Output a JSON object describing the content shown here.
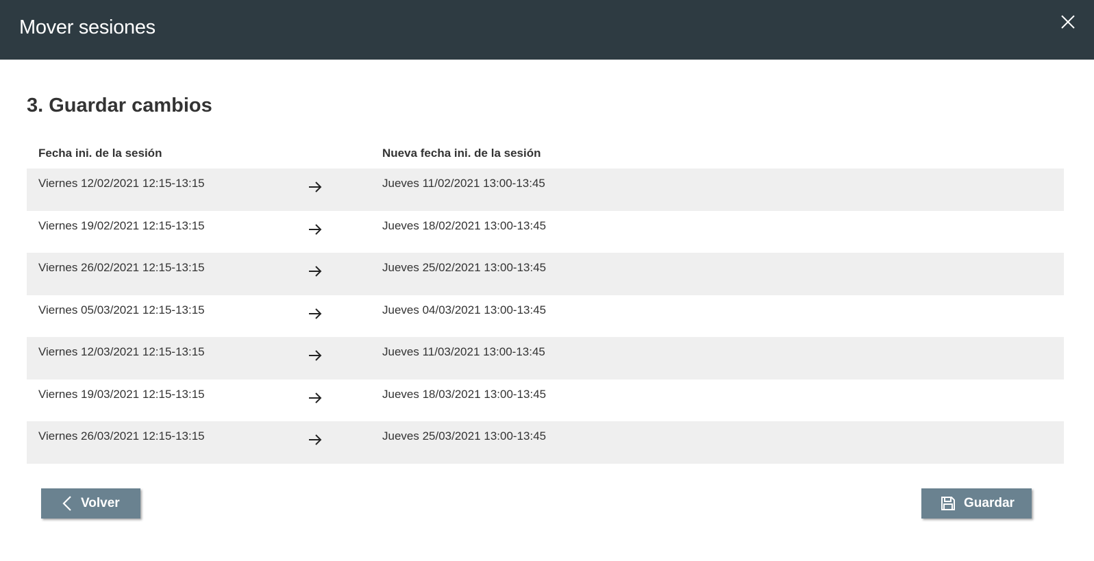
{
  "window": {
    "title": "Mover sesiones"
  },
  "step": {
    "title": "3. Guardar cambios"
  },
  "table": {
    "headers": {
      "original": "Fecha ini. de la sesión",
      "new": "Nueva fecha ini. de la sesión"
    },
    "rows": [
      {
        "original": "Viernes 12/02/2021 12:15-13:15",
        "new": "Jueves 11/02/2021 13:00-13:45"
      },
      {
        "original": "Viernes 19/02/2021 12:15-13:15",
        "new": "Jueves 18/02/2021 13:00-13:45"
      },
      {
        "original": "Viernes 26/02/2021 12:15-13:15",
        "new": "Jueves 25/02/2021 13:00-13:45"
      },
      {
        "original": "Viernes 05/03/2021 12:15-13:15",
        "new": "Jueves 04/03/2021 13:00-13:45"
      },
      {
        "original": "Viernes 12/03/2021 12:15-13:15",
        "new": "Jueves 11/03/2021 13:00-13:45"
      },
      {
        "original": "Viernes 19/03/2021 12:15-13:15",
        "new": "Jueves 18/03/2021 13:00-13:45"
      },
      {
        "original": "Viernes 26/03/2021 12:15-13:15",
        "new": "Jueves 25/03/2021 13:00-13:45"
      }
    ]
  },
  "buttons": {
    "back_label": "Volver",
    "save_label": "Guardar"
  },
  "icons": {
    "close": "close-icon",
    "arrow": "arrow-right-icon",
    "back": "chevron-left-icon",
    "save": "floppy-disk-icon"
  },
  "colors": {
    "titlebar": "#2e3b42",
    "button": "#6a8290",
    "row_alt": "#efefef"
  }
}
